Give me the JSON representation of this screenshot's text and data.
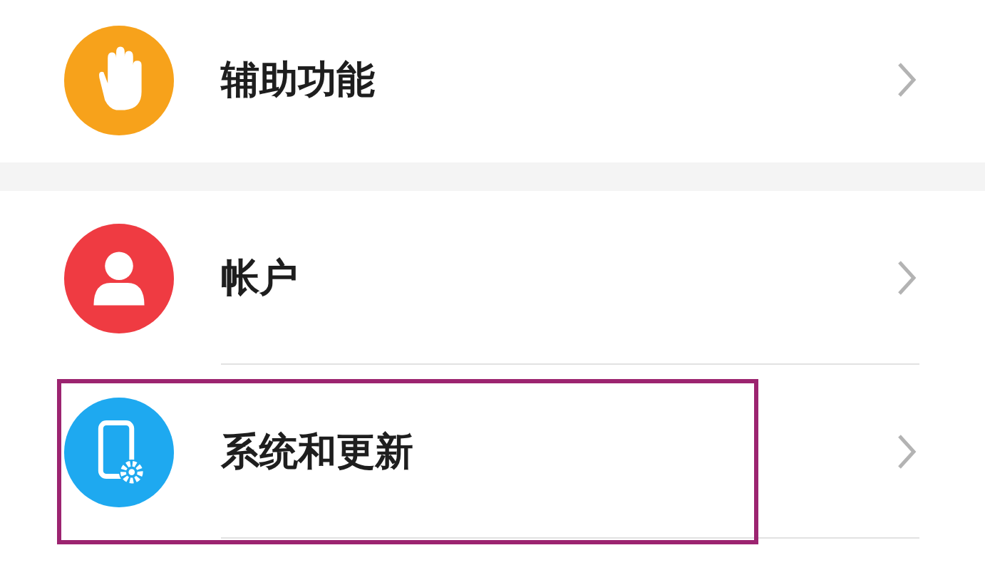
{
  "groups": [
    {
      "items": [
        {
          "kind": "hand",
          "color": "#f7a21b",
          "label": "辅助功能",
          "highlighted": false
        }
      ]
    },
    {
      "items": [
        {
          "kind": "person",
          "color": "#ef3b42",
          "label": "帐户",
          "highlighted": false
        },
        {
          "kind": "phone-gear",
          "color": "#1ea9f0",
          "label": "系统和更新",
          "highlighted": true
        }
      ]
    }
  ]
}
